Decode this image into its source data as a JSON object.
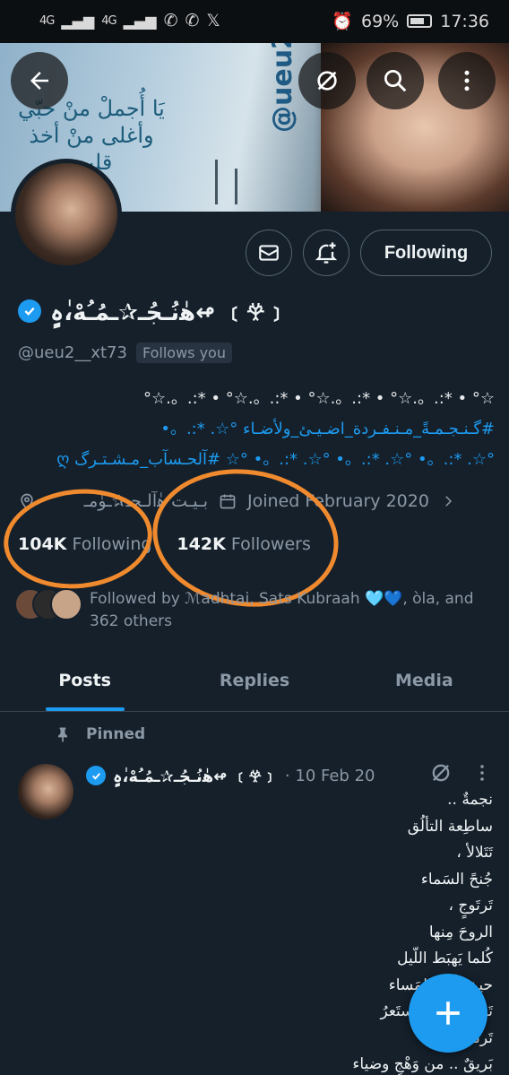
{
  "status_bar": {
    "left_signal_1": "4G",
    "left_signal_2": "4G",
    "battery_percent": "69%",
    "time": "17:36"
  },
  "profile": {
    "display_name": "ﻫٰنُـجُـ✰ـمُـُهْ،ٰہٍ↫ ﹝𖣂﹞",
    "handle": "@ueu2__xt73",
    "follows_you": "Follows you",
    "following_button": "Following",
    "bio_lines": [
      "☆° • *:.。.☆° • *:.。.☆° • *:.。.☆° • *:.。.☆°",
      "#گـنـجـمـةً_مـنـفـردة_اضـيـئ_ولأضـاء °☆. *:.。• ",
      "°☆. *:.。• °☆. *:.。• °☆. *:.。• °☆ #آلحـسآب_مـشـتـرگ ღ"
    ],
    "location": "بـيـت ﻫٰآلـجـ✰ـوٰمـ",
    "joined": "Joined February 2020",
    "following_count": "104K",
    "following_label": "Following",
    "followers_count": "142K",
    "followers_label": "Followers",
    "followed_by": "Followed by ℳadhtai, Sats Kubraah 🩵💙, òla, and 362 others"
  },
  "banner": {
    "arabic_text": "يَا أُجملْ منْ حبّي وأغلى منْ أخذ قلبي",
    "tag": "@ueu2"
  },
  "tabs": [
    {
      "label": "Posts",
      "active": true
    },
    {
      "label": "Replies",
      "active": false
    },
    {
      "label": "Media",
      "active": false
    }
  ],
  "pinned_post": {
    "pinned_label": "Pinned",
    "author": "ﻫٰنُـجُـ✰ـمُـُهْ،ٰہٍ↫ ﹝𖣂﹞",
    "date": "· 10 Feb 20",
    "lines": [
      "نجمةٌ ..",
      "ساطِعة التألُق",
      "تَتَلالأ ،",
      "جُنحً السَماء",
      "تَرتَوجٍ ،",
      "الروحَ مِنها",
      "كُلما يَهبَط اللّيل",
      "حينَ يأتي المَساء",
      "تَرسمُ طيفاً يَستَعرُ",
      "تَرتَقي ..",
      "بَريقٌ .. من وَهْجٍ وضياء"
    ]
  },
  "colors": {
    "background": "#15202b",
    "accent": "#1d9bf0",
    "annotation": "#f08a2e",
    "muted": "#8b98a5"
  },
  "icons": [
    "back-arrow-icon",
    "grok-icon",
    "search-icon",
    "more-vertical-icon",
    "mail-icon",
    "bell-plus-icon",
    "verified-icon",
    "location-icon",
    "calendar-icon",
    "chevron-right-icon",
    "pin-icon",
    "plus-icon"
  ]
}
